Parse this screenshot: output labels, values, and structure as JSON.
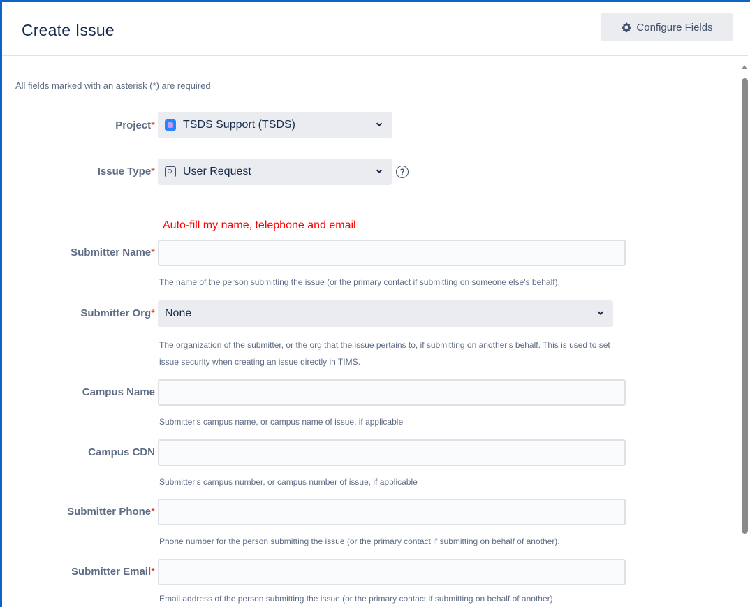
{
  "dialog": {
    "title": "Create Issue",
    "configure_fields_label": "Configure Fields"
  },
  "form": {
    "required_note": "All fields marked with an asterisk (*) are required",
    "project": {
      "label": "Project",
      "value": "TSDS Support (TSDS)"
    },
    "issue_type": {
      "label": "Issue Type",
      "value": "User Request"
    },
    "autofill_link": "Auto-fill my name, telephone and email",
    "submitter_name": {
      "label": "Submitter Name",
      "value": "",
      "description": "The name of the person submitting the issue (or the primary contact if submitting on someone else's behalf)."
    },
    "submitter_org": {
      "label": "Submitter Org",
      "value": "None",
      "description_line1": "The organization of the submitter, or the org that the issue pertains to, if submitting on another's behalf. This is used to set",
      "description_line2": "issue security when creating an issue directly in TIMS."
    },
    "campus_name": {
      "label": "Campus Name",
      "value": "",
      "description": "Submitter's campus name, or campus name of issue, if applicable"
    },
    "campus_cdn": {
      "label": "Campus CDN",
      "value": "",
      "description": "Submitter's campus number, or campus number of issue, if applicable"
    },
    "submitter_phone": {
      "label": "Submitter Phone",
      "value": "",
      "description": "Phone number for the person submitting the issue (or the primary contact if submitting on behalf of another)."
    },
    "submitter_email": {
      "label": "Submitter Email",
      "value": "",
      "description": "Email address of the person submitting the issue (or the primary contact if submitting on behalf of another)."
    },
    "required_mark": "*"
  },
  "colors": {
    "accent_border": "#0b66c3",
    "required": "#de350b",
    "autofill": "#ff0000"
  }
}
